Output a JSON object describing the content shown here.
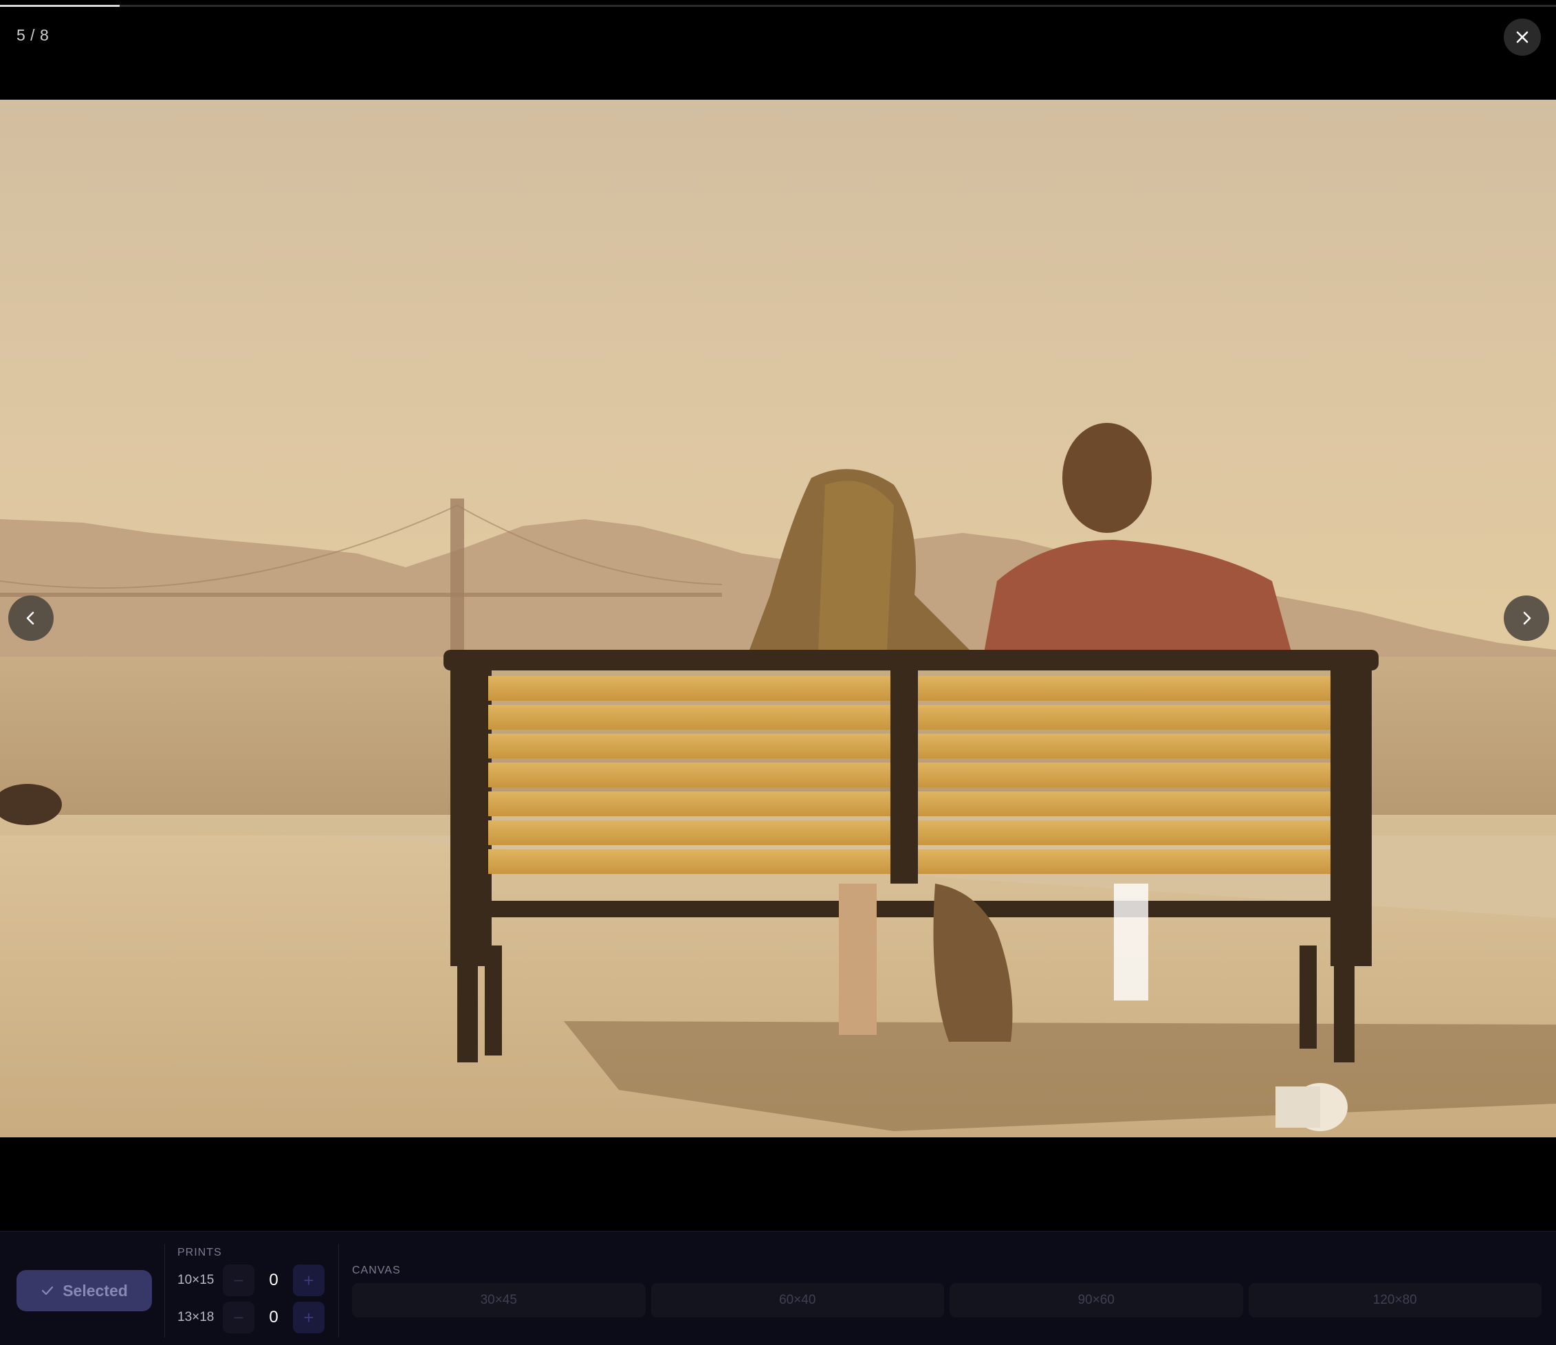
{
  "viewer": {
    "counter": "5 / 8",
    "progress_fraction": 0.077
  },
  "icons": {
    "close": "close-icon",
    "prev": "chevron-left-icon",
    "next": "chevron-right-icon",
    "check": "check-icon"
  },
  "photo": {
    "alt": "Couple sitting on a bench facing the bay with the Golden Gate Bridge"
  },
  "panel": {
    "select_label": "Selected",
    "prints_label": "PRINTS",
    "canvas_label": "CANVAS",
    "prints": [
      {
        "size": "10×15",
        "qty": "0",
        "minus": "−",
        "plus": "+"
      },
      {
        "size": "13×18",
        "qty": "0",
        "minus": "−",
        "plus": "+"
      }
    ],
    "canvas_sizes": [
      "30×45",
      "60×40",
      "90×60",
      "120×80"
    ]
  },
  "colors": {
    "background": "#000000",
    "panel": "#0c0c18",
    "accent": "#383868"
  }
}
